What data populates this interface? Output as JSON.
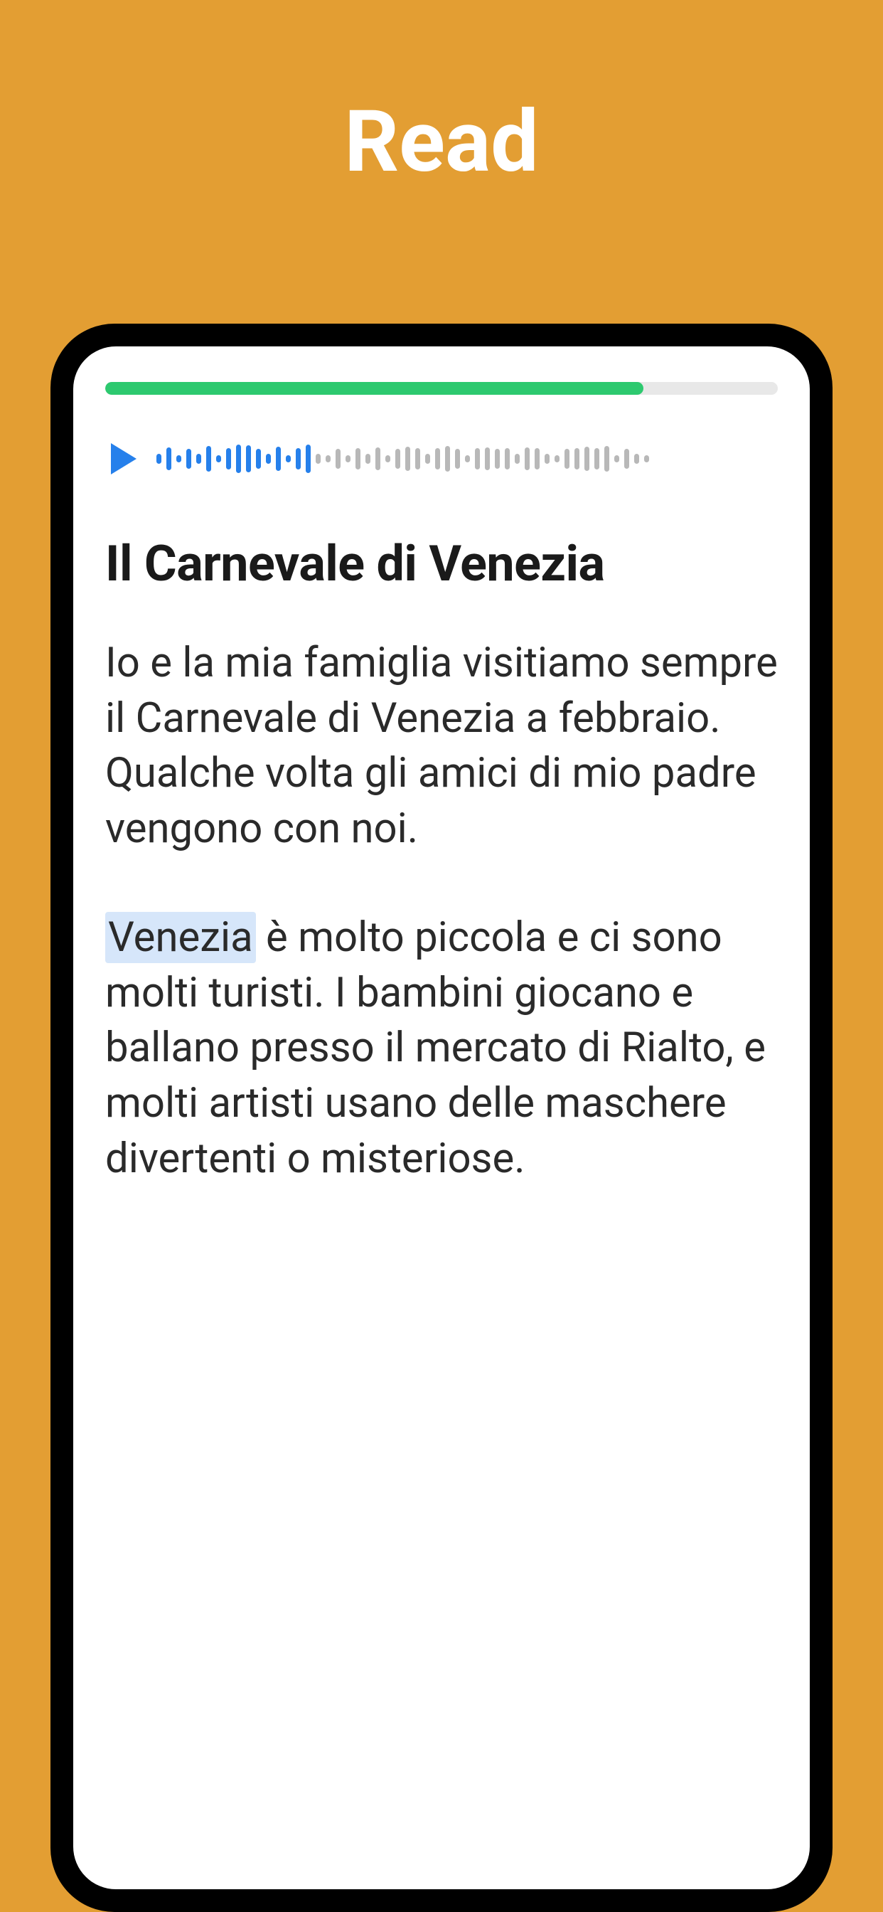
{
  "header": {
    "title": "Read"
  },
  "progress": {
    "percent": 80
  },
  "audio": {
    "playedPortion": 0.32
  },
  "story": {
    "title": "Il Carnevale di Venezia",
    "paragraph1": "Io e la mia famiglia visitiamo sempre il Carnevale di Venezia a febbraio. Qualche volta gli amici di mio padre vengono con noi.",
    "highlightedWord": "Venezia",
    "paragraph2Rest": " è molto piccola e ci sono molti turisti. I bambini giocano e ballano presso il mercato di Rialto, e molti artisti usano delle maschere divertenti o misteriose."
  },
  "colors": {
    "background": "#e39e33",
    "progress": "#2dc96f",
    "accent": "#2680eb",
    "highlight": "#d6e6fa"
  }
}
